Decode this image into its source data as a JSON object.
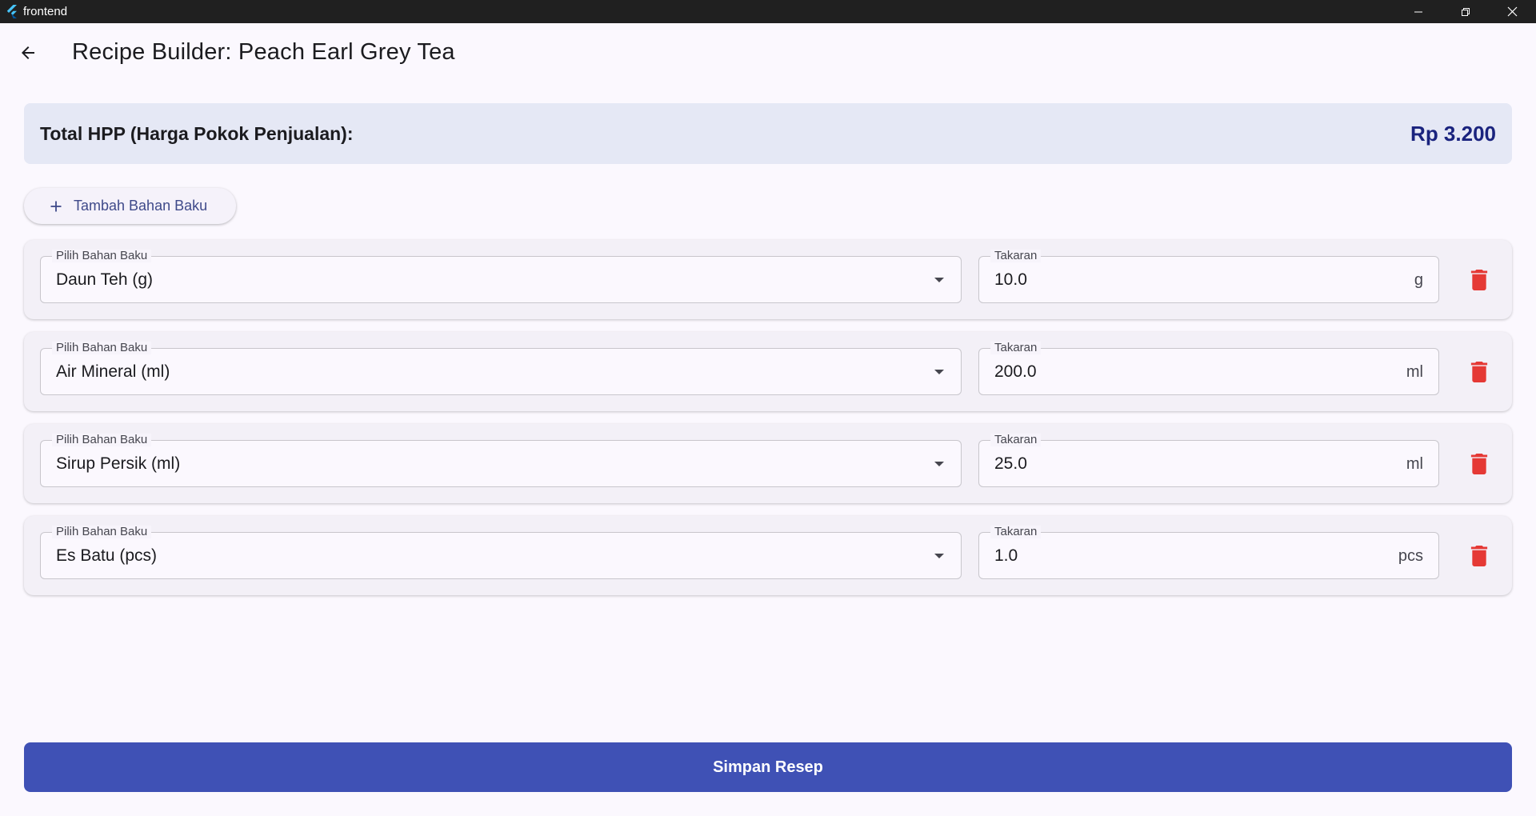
{
  "window": {
    "title": "frontend",
    "controls": [
      "minimize",
      "restore",
      "close"
    ]
  },
  "appbar": {
    "title": "Recipe Builder: Peach Earl Grey Tea",
    "back_icon": "arrow-back-icon"
  },
  "summary": {
    "label": "Total HPP (Harga Pokok Penjualan):",
    "value": "Rp 3.200",
    "value_color": "#1a237e"
  },
  "add_button": {
    "label": "Tambah Bahan Baku",
    "icon": "plus-icon"
  },
  "ingredients": [
    {
      "select_label": "Pilih Bahan Baku",
      "select_value": "Daun Teh (g)",
      "qty_label": "Takaran",
      "qty_value": "10.0",
      "unit": "g"
    },
    {
      "select_label": "Pilih Bahan Baku",
      "select_value": "Air Mineral (ml)",
      "qty_label": "Takaran",
      "qty_value": "200.0",
      "unit": "ml"
    },
    {
      "select_label": "Pilih Bahan Baku",
      "select_value": "Sirup Persik (ml)",
      "qty_label": "Takaran",
      "qty_value": "25.0",
      "unit": "ml"
    },
    {
      "select_label": "Pilih Bahan Baku",
      "select_value": "Es Batu (pcs)",
      "qty_label": "Takaran",
      "qty_value": "1.0",
      "unit": "pcs"
    }
  ],
  "save_button": {
    "label": "Simpan Resep",
    "color": "#3f51b5"
  },
  "colors": {
    "delete": "#e53935",
    "background": "#fbf8fe"
  }
}
